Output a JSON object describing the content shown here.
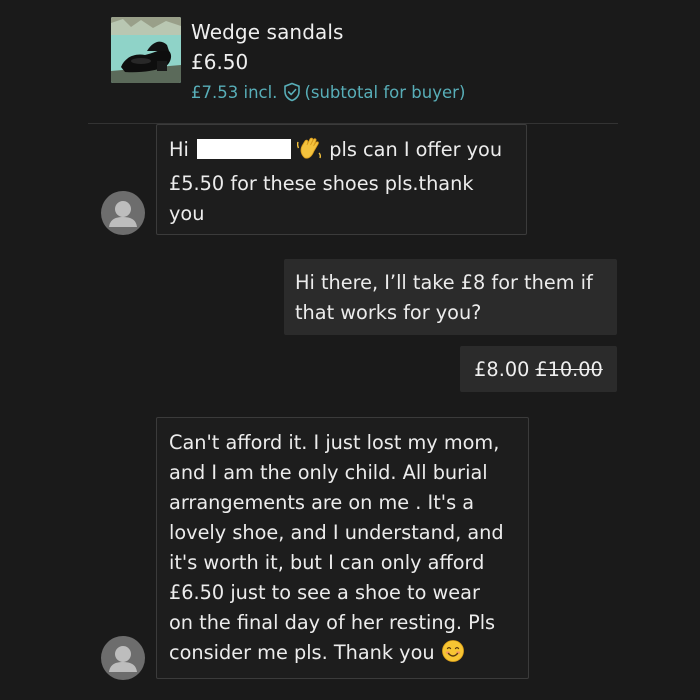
{
  "item": {
    "thumbnail_icon": "wedge-sandal-photo",
    "title": "Wedge sandals",
    "price": "£6.50",
    "buyer_price": "£7.53 incl.",
    "buyer_price_note": "(subtotal for buyer)",
    "protection_icon": "shield-check-icon",
    "accent_color": "#58aeb8"
  },
  "messages": [
    {
      "direction": "incoming",
      "lines": {
        "l1_greeting": "Hi",
        "l1_rest": " pls  can I offer you",
        "l2": "£5.50 for these shoes pls.thank",
        "l3": "you"
      },
      "redacted_name": true,
      "emoji": "waving-hand-emoji"
    },
    {
      "direction": "outgoing",
      "lines": {
        "l1": "Hi there, I’ll take £8 for them if",
        "l2": "that works for you?"
      }
    },
    {
      "direction": "incoming",
      "lines": {
        "l1": "Can't afford it. I just lost my mom,",
        "l2": "and I am the only child. All burial",
        "l3": "arrangements are on me . It's a",
        "l4": "lovely shoe, and I understand, and",
        "l5": "it's worth it, but I can only afford",
        "l6": "£6.50 just to see a shoe to wear",
        "l7": "on the final day of her resting. Pls",
        "l8": "consider me pls. Thank you"
      },
      "emoji": "smiling-face-emoji"
    }
  ],
  "offer": {
    "new_price": "£8.00",
    "old_price": "£10.00"
  }
}
